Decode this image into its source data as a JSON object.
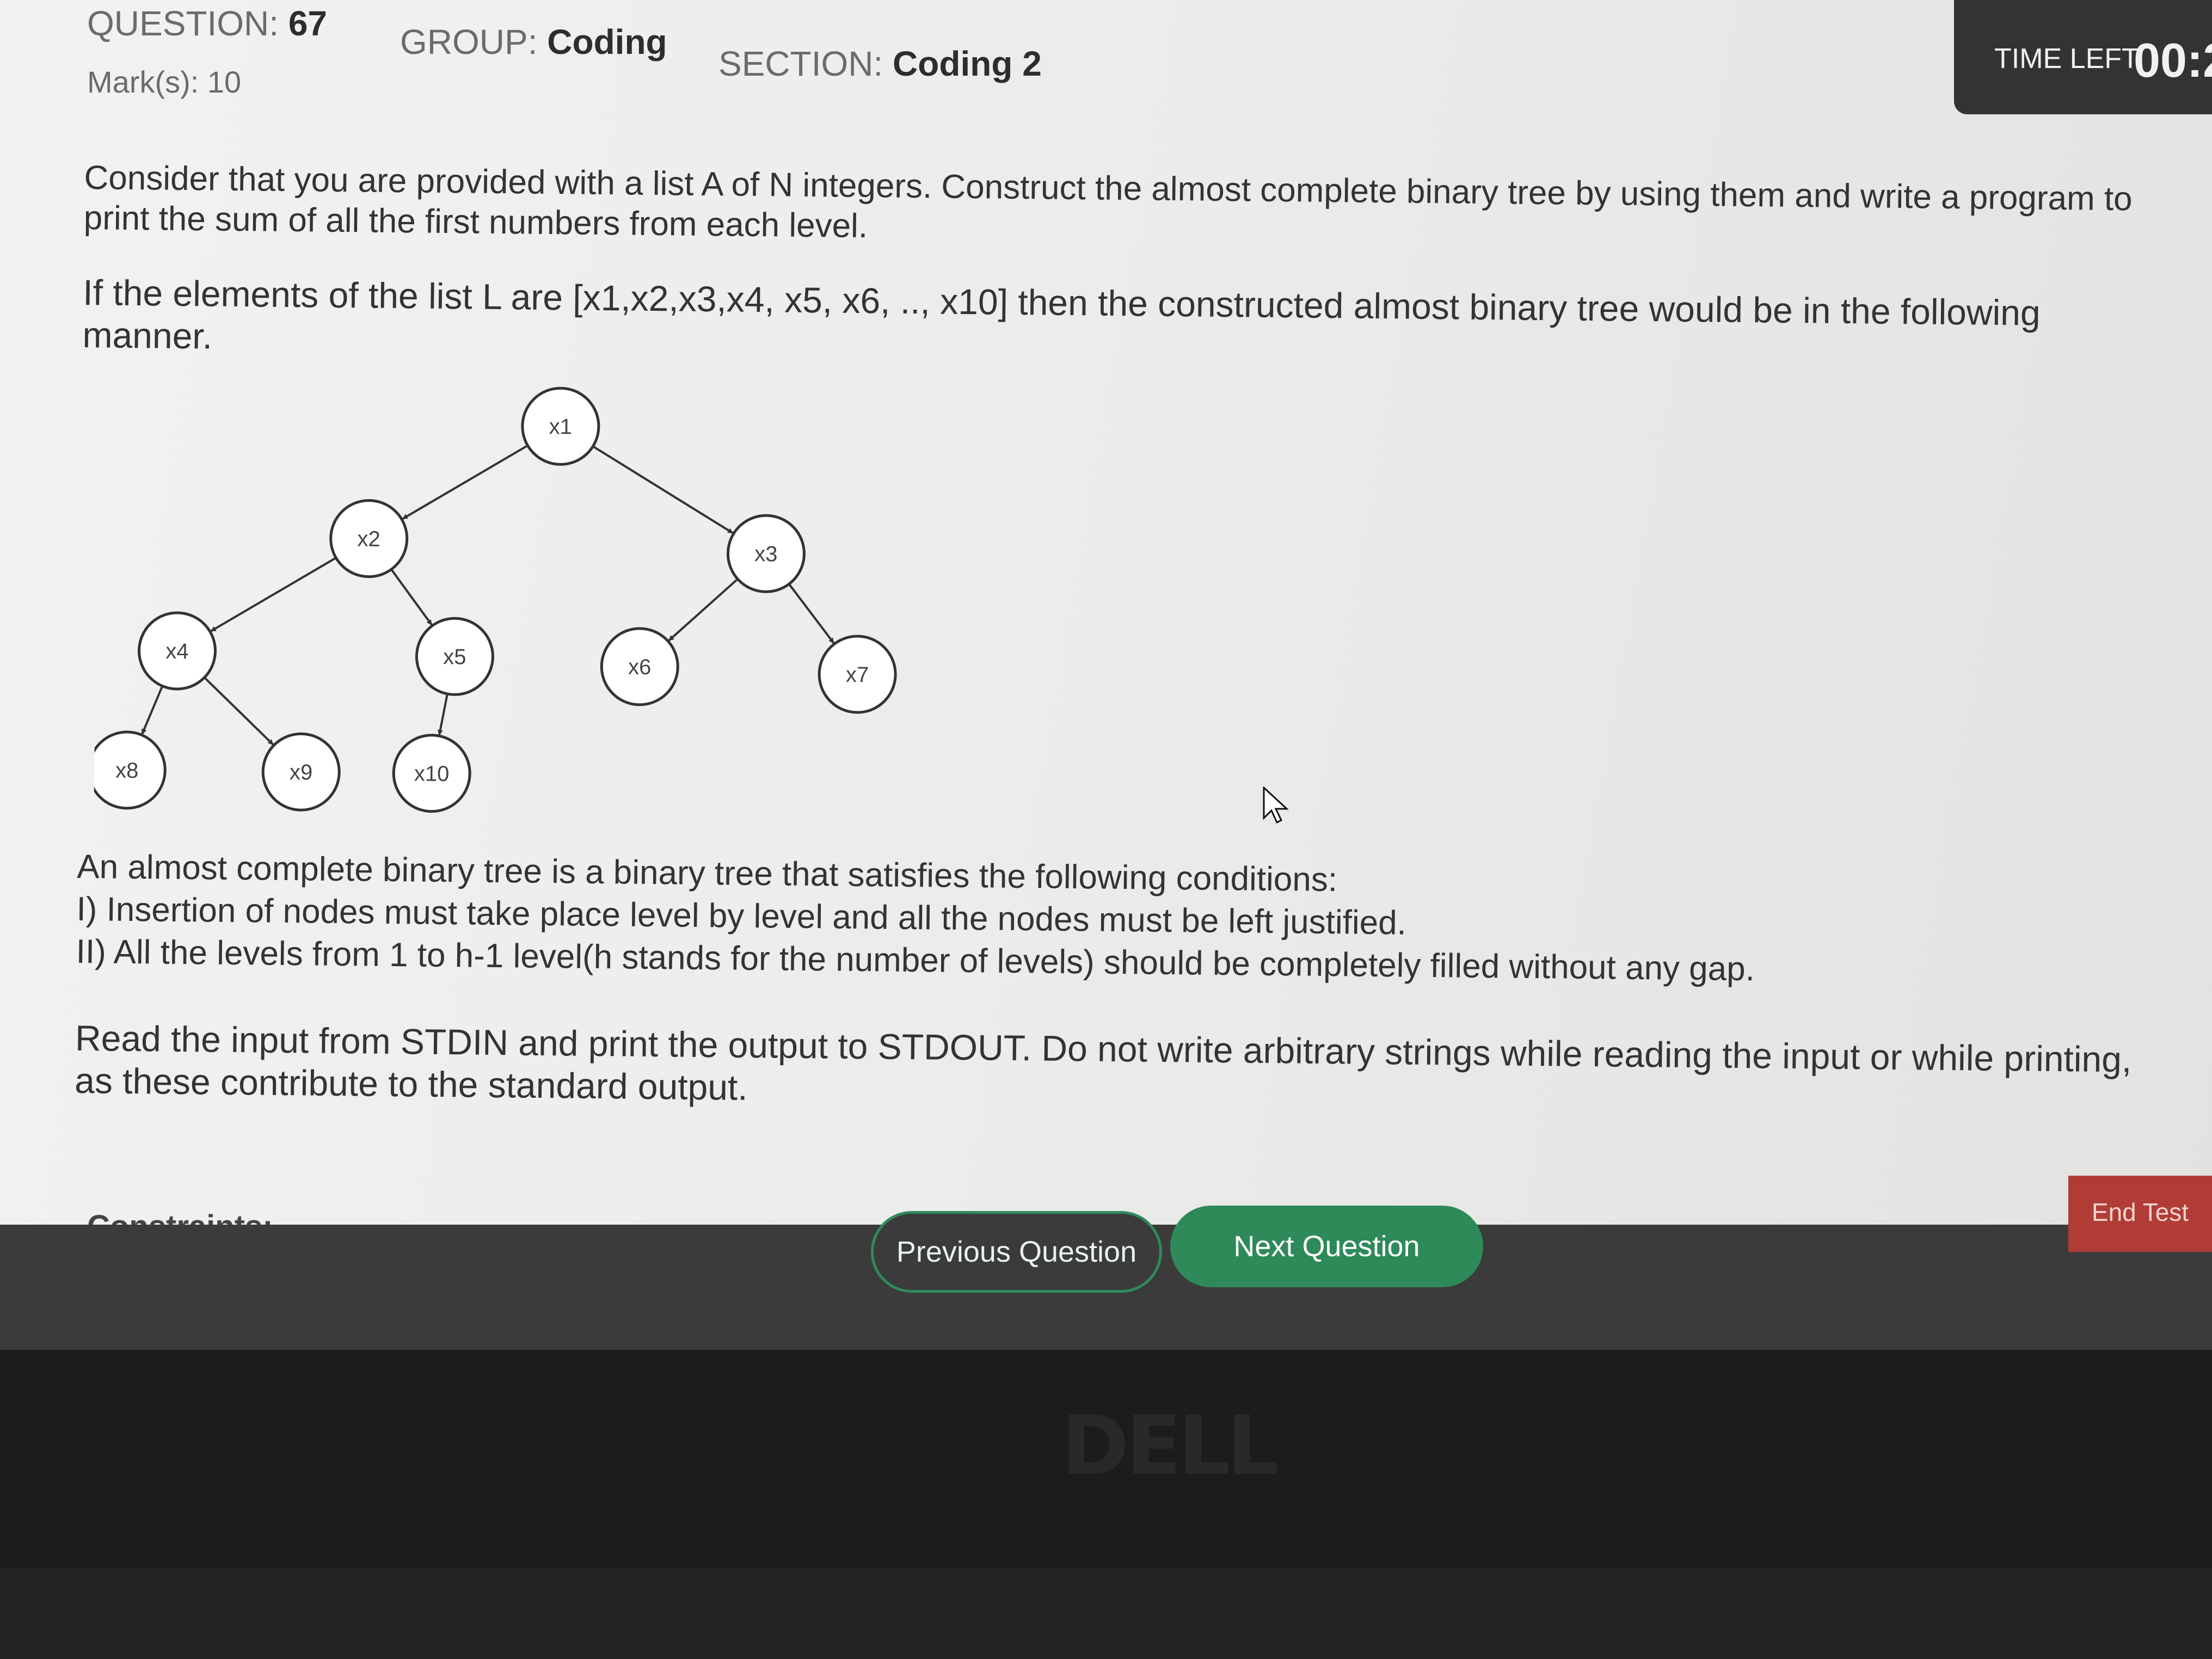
{
  "header": {
    "question_label": "QUESTION:",
    "question_number": "67",
    "group_label": "GROUP:",
    "group_value": "Coding",
    "section_label": "SECTION:",
    "section_value": "Coding 2",
    "marks_label": "Mark(s):",
    "marks_value": "10",
    "time_left_label": "TIME LEFT:",
    "time_left_value": "00:2"
  },
  "question": {
    "intro": "Consider that you are provided with a list A of N integers. Construct the almost complete binary tree by using them and write a program to print the sum of all the first numbers from each level.",
    "example": "If the elements of the list L are [x1,x2,x3,x4, x5, x6, .., x10] then the constructed almost binary tree would be in the following manner.",
    "tree_nodes": [
      "x1",
      "x2",
      "x3",
      "x4",
      "x5",
      "x6",
      "x7",
      "x8",
      "x9",
      "x10"
    ],
    "conditions_title": "An almost complete binary tree is a binary tree that satisfies the following conditions:",
    "condition_1": "I) Insertion of nodes must take place level by level and all the nodes must be left justified.",
    "condition_2": "II) All the levels from 1 to h-1 level(h stands for the number of levels) should be completely filled without any gap.",
    "io_note": "Read the input from STDIN and print the output to STDOUT. Do not write arbitrary strings while reading the input or while printing, as these contribute to the standard output.",
    "constraints_heading": "Constraints:"
  },
  "footer": {
    "previous_label": "Previous Question",
    "next_label": "Next Question",
    "end_label": "End Test"
  },
  "device": {
    "brand": "DELL"
  },
  "colors": {
    "accent_green": "#2e8a58",
    "end_red": "#b13c36",
    "bar_dark": "#3b3b3b"
  }
}
